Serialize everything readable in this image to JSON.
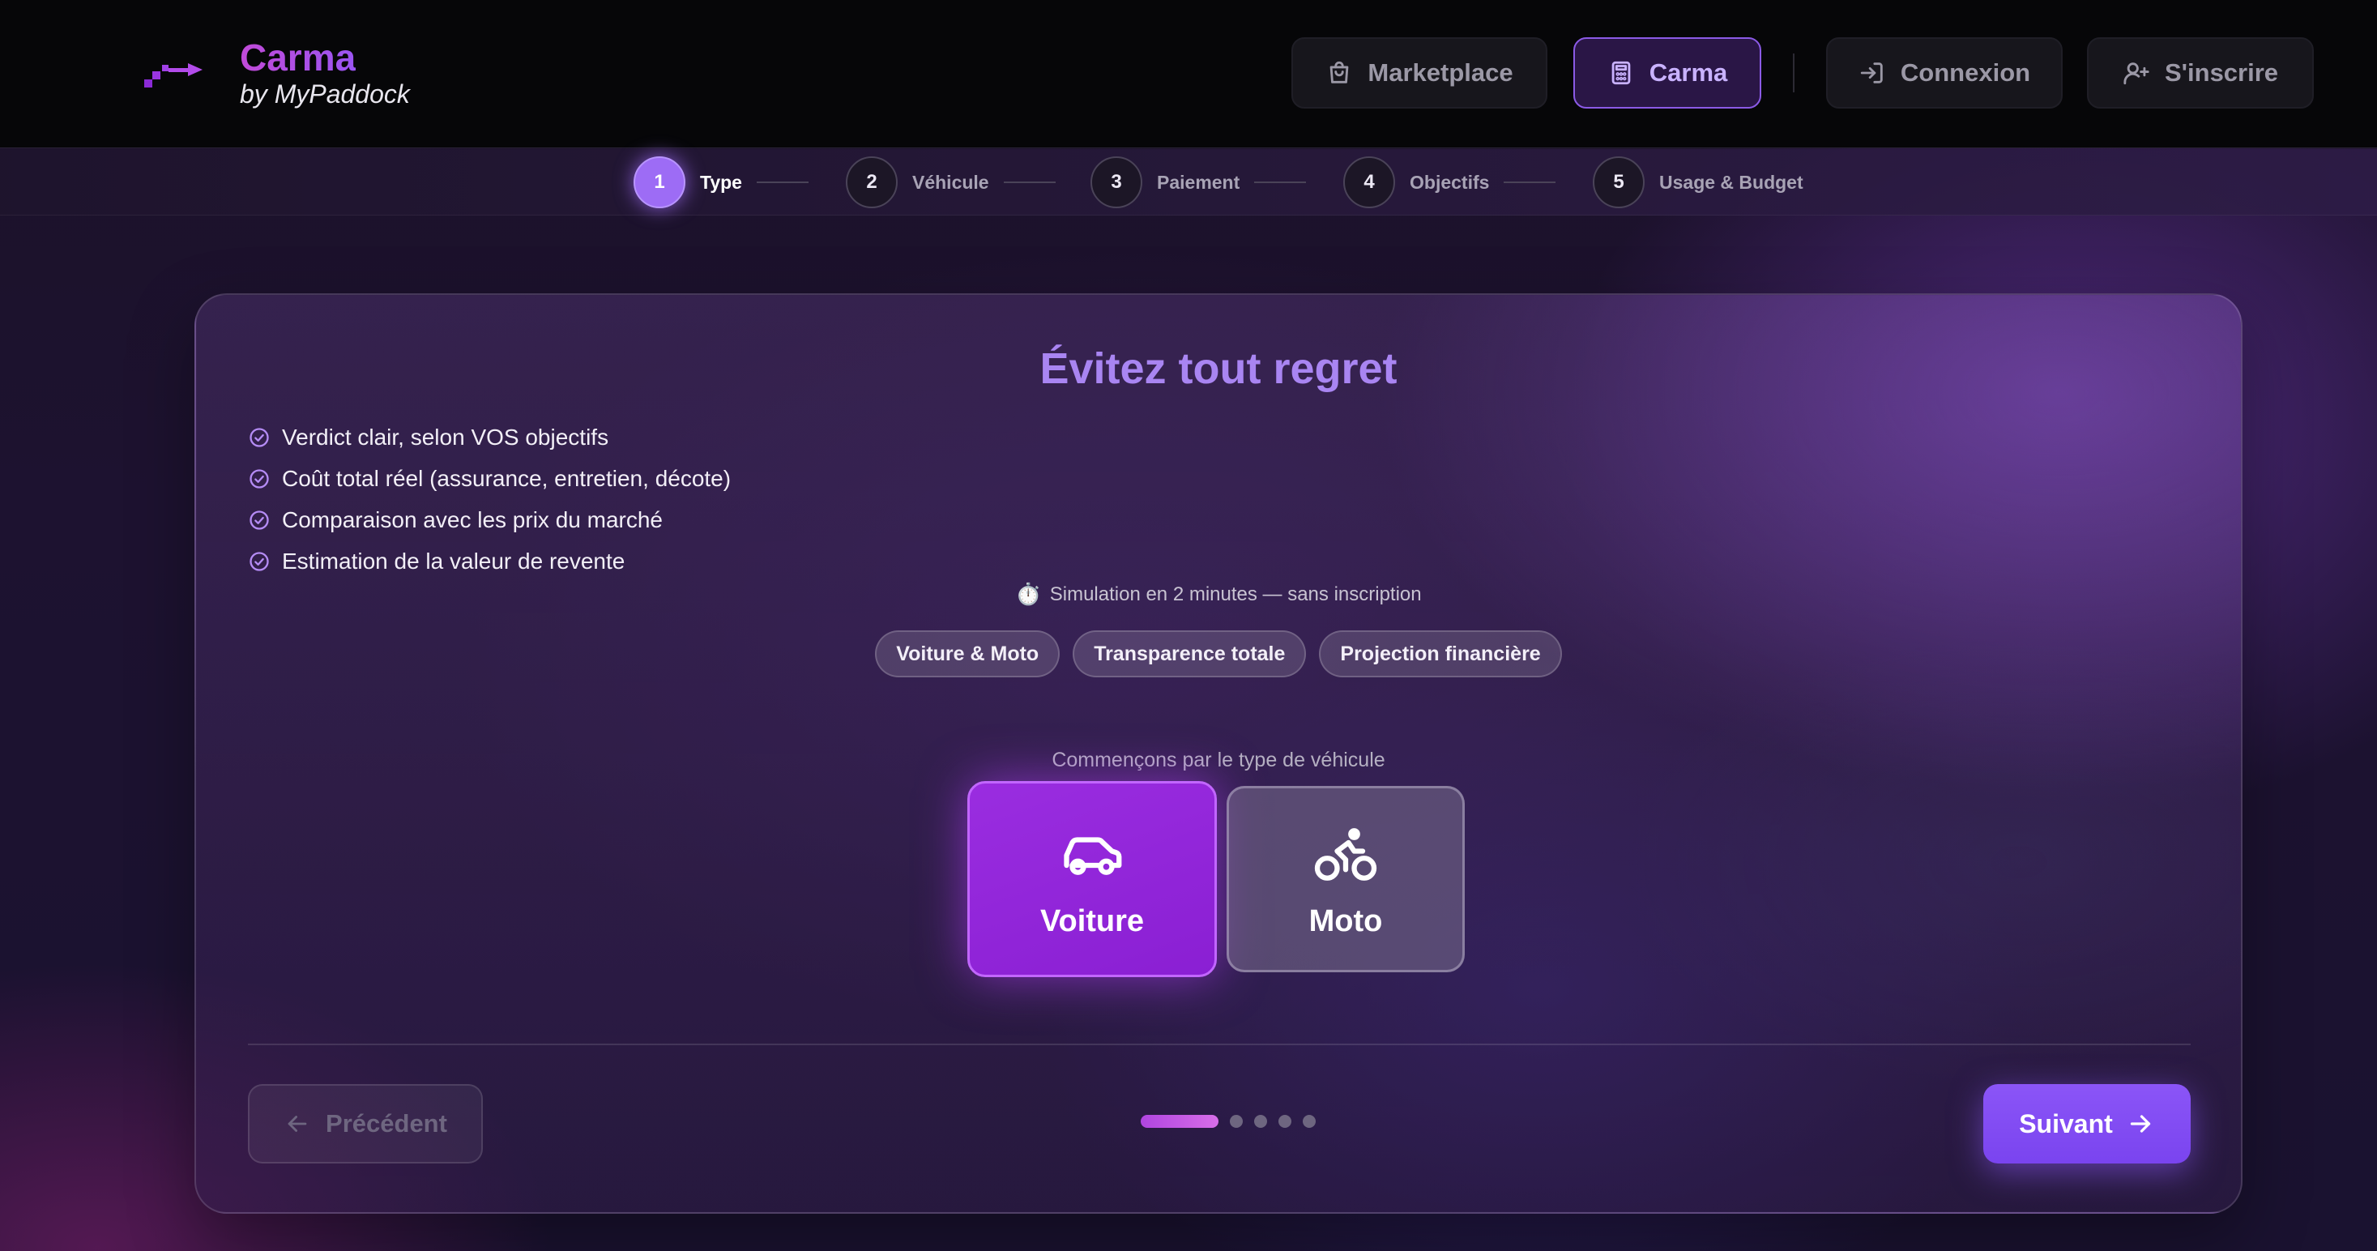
{
  "header": {
    "brand": "Carma",
    "brand_sub": "by MyPaddock",
    "nav": [
      {
        "label": "Marketplace",
        "icon": "shopping-bag-icon"
      },
      {
        "label": "Carma",
        "icon": "calculator-icon",
        "active": true
      },
      {
        "label": "Connexion",
        "icon": "login-icon"
      },
      {
        "label": "S'inscrire",
        "icon": "user-plus-icon"
      }
    ],
    "accent": "#9d6cf5"
  },
  "stepper": {
    "steps": [
      {
        "number": "1",
        "label": "Type",
        "active": true
      },
      {
        "number": "2",
        "label": "Véhicule"
      },
      {
        "number": "3",
        "label": "Paiement"
      },
      {
        "number": "4",
        "label": "Objectifs"
      },
      {
        "number": "5",
        "label": "Usage & Budget"
      }
    ]
  },
  "card": {
    "title": "Évitez tout regret",
    "features": [
      "Verdict clair, selon VOS objectifs",
      "Coût total réel (assurance, entretien, décote)",
      "Comparaison avec les prix du marché",
      "Estimation de la valeur de revente"
    ],
    "sim_note": "Simulation en 2 minutes — sans inscription",
    "sim_icon": "⏱️",
    "pills": [
      "Voiture & Moto",
      "Transparence totale",
      "Projection financière"
    ],
    "type_prompt": "Commençons par le type de véhicule",
    "types": [
      {
        "label": "Voiture",
        "icon": "car-icon",
        "selected": true
      },
      {
        "label": "Moto",
        "icon": "bike-icon",
        "selected": false
      }
    ],
    "prev_label": "Précédent",
    "next_label": "Suivant",
    "progress": {
      "current": 1,
      "total": 5
    }
  }
}
